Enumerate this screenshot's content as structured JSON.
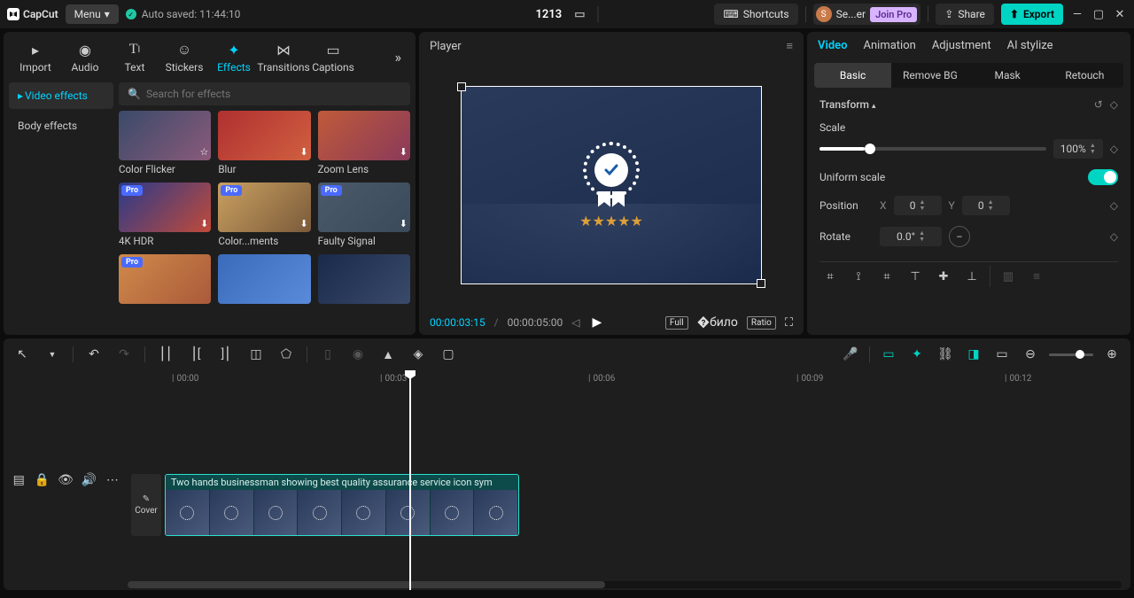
{
  "topbar": {
    "logo": "CapCut",
    "menu": "Menu",
    "autosave": "Auto saved: 11:44:10",
    "project_name": "1213",
    "shortcuts": "Shortcuts",
    "account": "Se...er",
    "join_pro": "Join Pro",
    "share": "Share",
    "export": "Export"
  },
  "media_tabs": {
    "import": "Import",
    "audio": "Audio",
    "text": "Text",
    "stickers": "Stickers",
    "effects": "Effects",
    "transitions": "Transitions",
    "captions": "Captions"
  },
  "effects_side": {
    "video": "Video effects",
    "body": "Body effects"
  },
  "search_placeholder": "Search for effects",
  "effects": {
    "e0": "Color Flicker",
    "e1": "Blur",
    "e2": "Zoom Lens",
    "e3": "4K HDR",
    "e4": "Color...ments",
    "e5": "Faulty Signal",
    "pro": "Pro"
  },
  "player": {
    "title": "Player",
    "time_current": "00:00:03:15",
    "time_total": "00:00:05:00",
    "full": "Full",
    "ratio": "Ratio"
  },
  "inspector": {
    "tabs": {
      "video": "Video",
      "animation": "Animation",
      "adjustment": "Adjustment",
      "ai": "AI stylize"
    },
    "subs": {
      "basic": "Basic",
      "removebg": "Remove BG",
      "mask": "Mask",
      "retouch": "Retouch"
    },
    "transform": "Transform",
    "scale": "Scale",
    "scale_val": "100%",
    "uniform": "Uniform scale",
    "position": "Position",
    "pos_x_label": "X",
    "pos_x": "0",
    "pos_y_label": "Y",
    "pos_y": "0",
    "rotate": "Rotate",
    "rotate_val": "0.0°",
    "mirror": "–"
  },
  "timeline": {
    "marks": {
      "m0": "00:00",
      "m1": "00:03",
      "m2": "00:06",
      "m3": "00:09",
      "m4": "00:12"
    },
    "clip_label": "Two hands businessman showing best quality assurance service icon sym",
    "cover": "Cover"
  }
}
